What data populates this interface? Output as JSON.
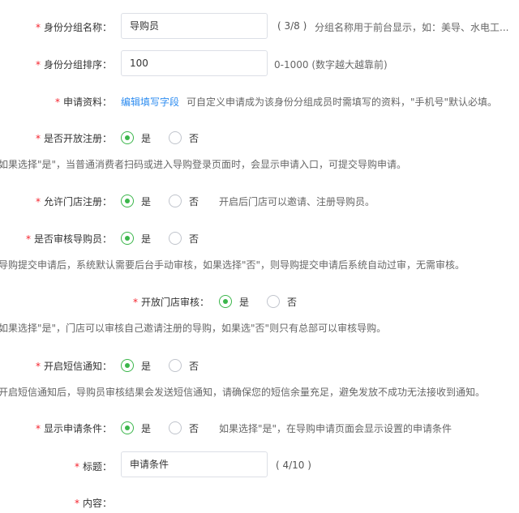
{
  "fields": {
    "group_name": {
      "label": "身份分组名称：",
      "value": "导购员",
      "counter": "( 3/8 )",
      "hint": "分组名称用于前台显示，如：美导、水电工..."
    },
    "group_sort": {
      "label": "身份分组排序：",
      "value": "100",
      "hint": "0-1000 (数字越大越靠前)"
    },
    "apply_info": {
      "label": "申请资料：",
      "link": "编辑填写字段",
      "hint": "可自定义申请成为该身份分组成员时需填写的资料，\"手机号\"默认必填。"
    },
    "open_register": {
      "label": "是否开放注册：",
      "yes": "是",
      "no": "否",
      "selected": "是",
      "note": "如果选择\"是\"，当普通消费者扫码或进入导购登录页面时，会显示申请入口，可提交导购申请。"
    },
    "store_register": {
      "label": "允许门店注册：",
      "yes": "是",
      "no": "否",
      "selected": "是",
      "hint": "开启后门店可以邀请、注册导购员。"
    },
    "audit_guide": {
      "label": "是否审核导购员：",
      "yes": "是",
      "no": "否",
      "selected": "是",
      "note": "导购提交申请后，系统默认需要后台手动审核，如果选择\"否\"，则导购提交申请后系统自动过审，无需审核。"
    },
    "store_audit": {
      "label": "开放门店审核：",
      "yes": "是",
      "no": "否",
      "selected": "是",
      "note": "如果选择\"是\"，门店可以审核自己邀请注册的导购，如果选\"否\"则只有总部可以审核导购。"
    },
    "sms_notify": {
      "label": "开启短信通知：",
      "yes": "是",
      "no": "否",
      "selected": "是",
      "note": "开启短信通知后，导购员审核结果会发送短信通知，请确保您的短信余量充足，避免发放不成功无法接收到通知。"
    },
    "show_conditions": {
      "label": "显示申请条件：",
      "yes": "是",
      "no": "否",
      "selected": "是",
      "hint": "如果选择\"是\"，在导购申请页面会显示设置的申请条件"
    },
    "title": {
      "label": "标题：",
      "value": "申请条件",
      "counter": "( 4/10 )"
    },
    "content": {
      "label": "内容："
    }
  },
  "required_mark": "*",
  "colors": {
    "accent": "#3bb64b",
    "link": "#2d8cf0",
    "required": "#f5222d",
    "border": "#dcdfe6"
  }
}
